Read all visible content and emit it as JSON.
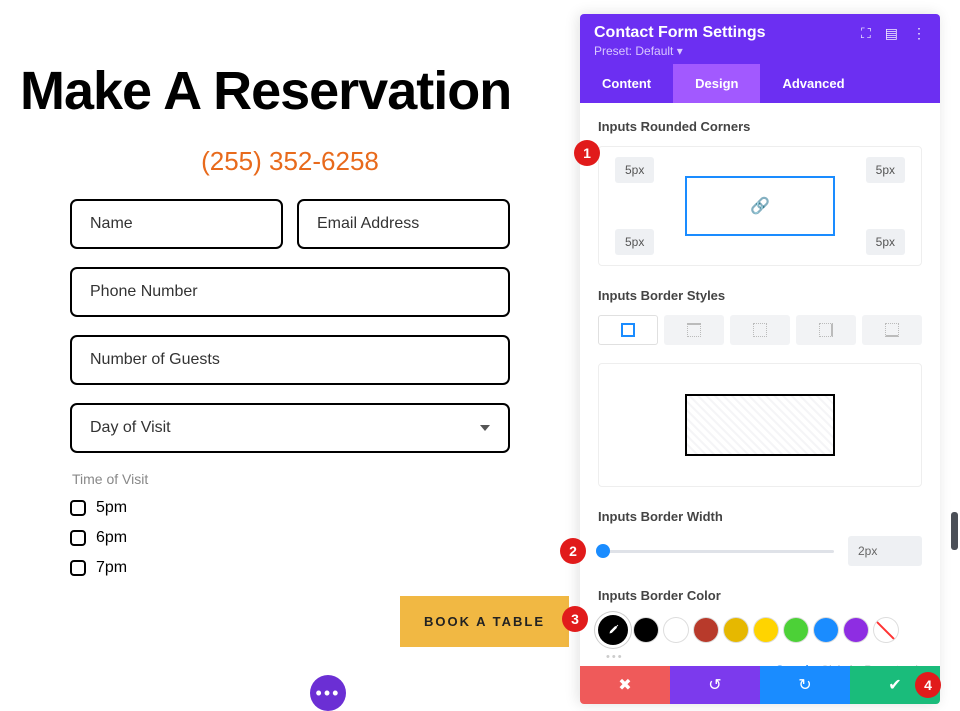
{
  "preview": {
    "heading": "Make A Reservation",
    "phone": "(255) 352-6258",
    "fields": {
      "name_placeholder": "Name",
      "email_placeholder": "Email Address",
      "phone_placeholder": "Phone Number",
      "guests_placeholder": "Number of Guests",
      "day_select": "Day of Visit"
    },
    "time_label": "Time of Visit",
    "time_options": [
      "5pm",
      "6pm",
      "7pm"
    ],
    "submit_label": "BOOK A TABLE"
  },
  "panel": {
    "title": "Contact Form Settings",
    "preset": "Preset: Default ▾",
    "tabs": {
      "content": "Content",
      "design": "Design",
      "advanced": "Advanced"
    },
    "sections": {
      "rounded_label": "Inputs Rounded Corners",
      "corner_tl": "5px",
      "corner_tr": "5px",
      "corner_bl": "5px",
      "corner_br": "5px",
      "border_styles_label": "Inputs Border Styles",
      "border_width_label": "Inputs Border Width",
      "border_width_value": "2px",
      "border_color_label": "Inputs Border Color"
    },
    "swatches": [
      "#000000",
      "#ffffff",
      "#b83a2b",
      "#e6b800",
      "#ffd400",
      "#4cd137",
      "#1a8cff",
      "#8e2de2"
    ],
    "palette_tabs": {
      "saved": "Saved",
      "global": "Global",
      "recent": "Recent"
    }
  },
  "steps": {
    "s1": "1",
    "s2": "2",
    "s3": "3",
    "s4": "4"
  }
}
